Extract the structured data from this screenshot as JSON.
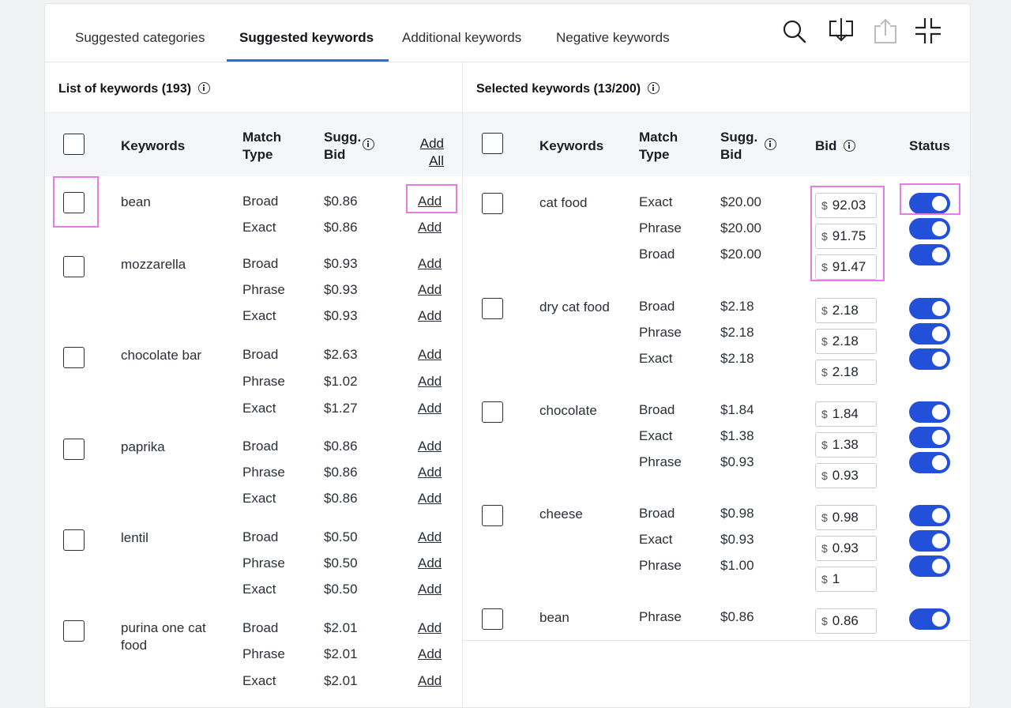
{
  "tabs": [
    {
      "label": "Suggested categories"
    },
    {
      "label": "Suggested keywords"
    },
    {
      "label": "Additional keywords"
    },
    {
      "label": "Negative keywords"
    }
  ],
  "left": {
    "title": "List of keywords (193)",
    "headers": {
      "keywords": "Keywords",
      "match1": "Match",
      "match2": "Type",
      "sugg1": "Sugg.",
      "sugg2": "Bid",
      "addall1": "Add",
      "addall2": "All"
    },
    "add_label": "Add",
    "rows": [
      {
        "keyword": "bean",
        "lines": [
          {
            "type": "Broad",
            "bid": "$0.86"
          },
          {
            "type": "Exact",
            "bid": "$0.86"
          }
        ]
      },
      {
        "keyword": "mozzarella",
        "lines": [
          {
            "type": "Broad",
            "bid": "$0.93"
          },
          {
            "type": "Phrase",
            "bid": "$0.93"
          },
          {
            "type": "Exact",
            "bid": "$0.93"
          }
        ]
      },
      {
        "keyword": "chocolate bar",
        "lines": [
          {
            "type": "Broad",
            "bid": "$2.63"
          },
          {
            "type": "Phrase",
            "bid": "$1.02"
          },
          {
            "type": "Exact",
            "bid": "$1.27"
          }
        ]
      },
      {
        "keyword": "paprika",
        "lines": [
          {
            "type": "Broad",
            "bid": "$0.86"
          },
          {
            "type": "Phrase",
            "bid": "$0.86"
          },
          {
            "type": "Exact",
            "bid": "$0.86"
          }
        ]
      },
      {
        "keyword": "lentil",
        "lines": [
          {
            "type": "Broad",
            "bid": "$0.50"
          },
          {
            "type": "Phrase",
            "bid": "$0.50"
          },
          {
            "type": "Exact",
            "bid": "$0.50"
          }
        ]
      },
      {
        "keyword": "purina one cat food",
        "lines": [
          {
            "type": "Broad",
            "bid": "$2.01"
          },
          {
            "type": "Phrase",
            "bid": "$2.01"
          },
          {
            "type": "Exact",
            "bid": "$2.01"
          }
        ]
      }
    ]
  },
  "right": {
    "title": "Selected keywords (13/200)",
    "headers": {
      "keywords": "Keywords",
      "match1": "Match",
      "match2": "Type",
      "sugg1": "Sugg.",
      "sugg2": "Bid",
      "bid": "Bid",
      "status": "Status"
    },
    "currency": "$",
    "rows": [
      {
        "keyword": "cat food",
        "lines": [
          {
            "type": "Exact",
            "sugg": "$20.00",
            "bid": "92.03",
            "active": true
          },
          {
            "type": "Phrase",
            "sugg": "$20.00",
            "bid": "91.75",
            "active": true
          },
          {
            "type": "Broad",
            "sugg": "$20.00",
            "bid": "91.47",
            "active": true
          }
        ]
      },
      {
        "keyword": "dry cat food",
        "lines": [
          {
            "type": "Broad",
            "sugg": "$2.18",
            "bid": "2.18",
            "active": true
          },
          {
            "type": "Phrase",
            "sugg": "$2.18",
            "bid": "2.18",
            "active": true
          },
          {
            "type": "Exact",
            "sugg": "$2.18",
            "bid": "2.18",
            "active": true
          }
        ]
      },
      {
        "keyword": "chocolate",
        "lines": [
          {
            "type": "Broad",
            "sugg": "$1.84",
            "bid": "1.84",
            "active": true
          },
          {
            "type": "Exact",
            "sugg": "$1.38",
            "bid": "1.38",
            "active": true
          },
          {
            "type": "Phrase",
            "sugg": "$0.93",
            "bid": "0.93",
            "active": true
          }
        ]
      },
      {
        "keyword": "cheese",
        "lines": [
          {
            "type": "Broad",
            "sugg": "$0.98",
            "bid": "0.98",
            "active": true
          },
          {
            "type": "Exact",
            "sugg": "$0.93",
            "bid": "0.93",
            "active": true
          },
          {
            "type": "Phrase",
            "sugg": "$1.00",
            "bid": "1",
            "active": true
          }
        ]
      },
      {
        "keyword": "bean",
        "lines": [
          {
            "type": "Phrase",
            "sugg": "$0.86",
            "bid": "0.86",
            "active": true
          }
        ]
      }
    ]
  },
  "icons": {
    "search": "search-icon",
    "download": "download-icon",
    "share": "share-icon",
    "collapse": "collapse-icon",
    "info": "info-icon"
  },
  "colors": {
    "accent": "#2b6fd6",
    "toggle": "#2350d8",
    "highlight": "#e57ce8"
  }
}
